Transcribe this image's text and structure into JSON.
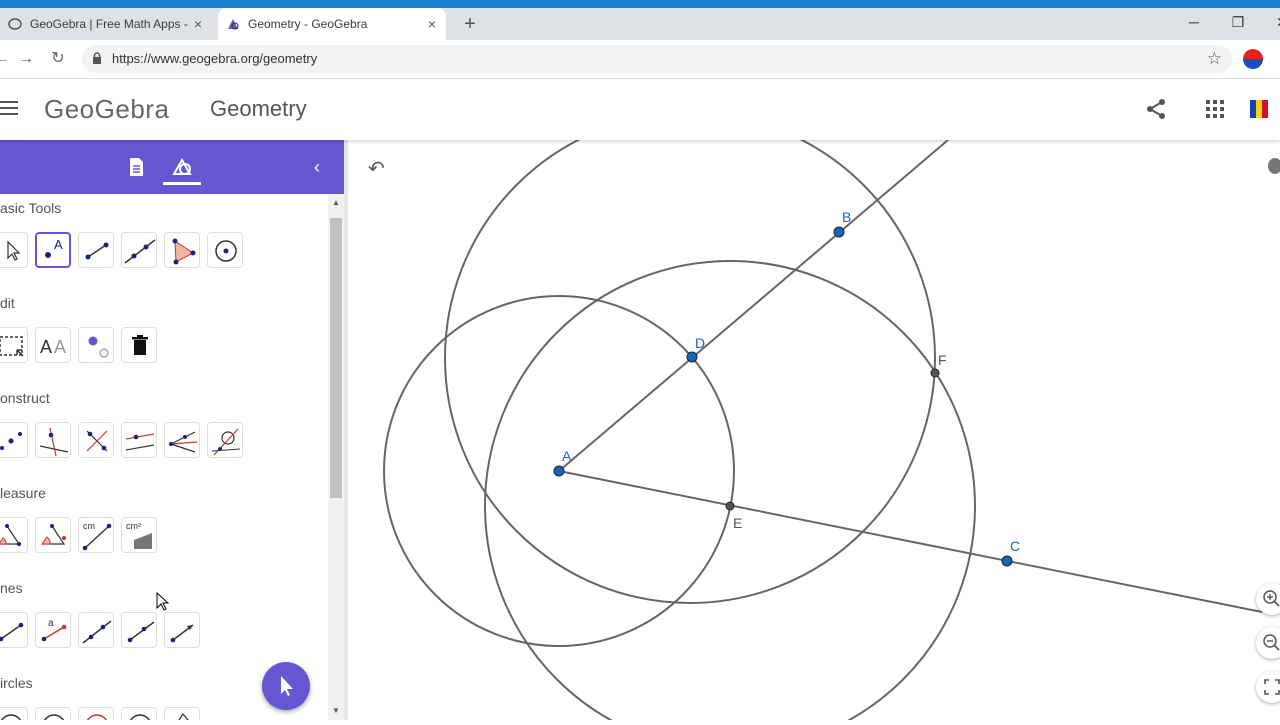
{
  "browser": {
    "tabs": [
      {
        "title": "GeoGebra | Free Math Apps - used",
        "active": false
      },
      {
        "title": "Geometry - GeoGebra",
        "active": true
      }
    ],
    "url": "https://www.geogebra.org/geometry",
    "new_tab": "+",
    "window_controls": {
      "minimize": "─",
      "restore": "❐",
      "close": "✕"
    }
  },
  "app": {
    "logo": "GeoGebra",
    "title": "Geometry"
  },
  "sidebar": {
    "categories": [
      {
        "label": "asic Tools",
        "tools": [
          "move-tool",
          "point-tool",
          "segment-tool",
          "line-tool",
          "polygon-tool",
          "circle-center-point-tool"
        ]
      },
      {
        "label": "dit",
        "tools": [
          "select-rectangle-tool",
          "text-tool",
          "show-hide-tool",
          "delete-tool"
        ]
      },
      {
        "label": "onstruct",
        "tools": [
          "midpoint-tool",
          "perpendicular-tool",
          "bisector-tool",
          "parallel-tool",
          "angle-bisector-tool",
          "tangent-tool"
        ]
      },
      {
        "label": "leasure",
        "tools": [
          "angle-tool",
          "angle-size-tool",
          "distance-tool",
          "area-tool"
        ]
      },
      {
        "label": "nes",
        "tools": [
          "segment-tool",
          "segment-length-tool",
          "line-tool",
          "ray-tool",
          "vector-tool"
        ]
      },
      {
        "label": "ircles",
        "tools": [
          "circle-tool",
          "circle-radius-tool",
          "compass-tool",
          "semicircle-tool",
          "arc-tool"
        ]
      }
    ],
    "measure_labels": {
      "distance": "cm",
      "area": "cm²"
    },
    "selected_tool": "point-tool"
  },
  "colors": {
    "accent": "#6557d2",
    "point": "#1565c0",
    "label": "#1565c0",
    "curve": "#666666"
  },
  "graphics": {
    "points": [
      {
        "label": "A",
        "type": "free"
      },
      {
        "label": "B",
        "type": "free"
      },
      {
        "label": "C",
        "type": "free"
      },
      {
        "label": "D",
        "type": "free"
      },
      {
        "label": "E",
        "type": "intersection"
      },
      {
        "label": "F",
        "type": "intersection"
      }
    ]
  }
}
